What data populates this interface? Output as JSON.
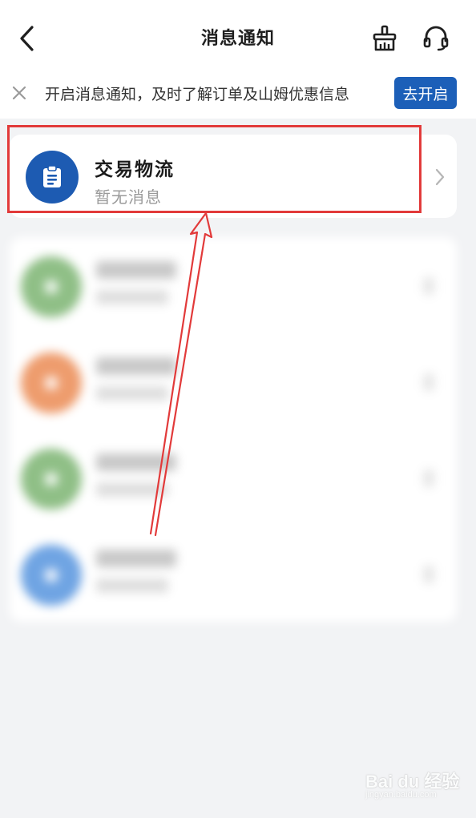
{
  "header": {
    "title": "消息通知",
    "back_icon": "chevron-left-icon",
    "clean_icon": "broom-icon",
    "service_icon": "headset-icon"
  },
  "banner": {
    "close_icon": "close-icon",
    "text": "开启消息通知，及时了解订单及山姆优惠信息",
    "button_label": "去开启"
  },
  "card": {
    "icon": "clipboard-icon",
    "title": "交易物流",
    "subtitle": "暂无消息",
    "chevron_icon": "chevron-right-icon"
  },
  "blurred_list": {
    "rows": [
      {
        "avatar_color": "#8fbf86"
      },
      {
        "avatar_color": "#ee9c6d"
      },
      {
        "avatar_color": "#8fbf86"
      },
      {
        "avatar_color": "#6fa4e3"
      }
    ]
  },
  "annotation": {
    "color": "#e23a3a"
  },
  "watermark": {
    "logo_text": "Bai du 经验",
    "sub_text": "jingyan.baidu.com"
  },
  "colors": {
    "accent": "#1c5fb8",
    "background": "#f2f3f5"
  }
}
